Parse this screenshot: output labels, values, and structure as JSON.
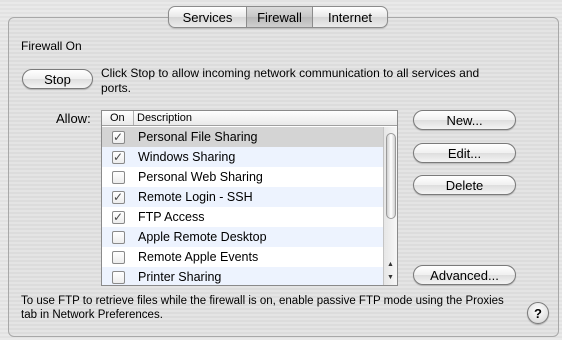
{
  "tabs": [
    {
      "label": "Services",
      "active": false
    },
    {
      "label": "Firewall",
      "active": true
    },
    {
      "label": "Internet",
      "active": false
    }
  ],
  "status_title": "Firewall On",
  "stop_button": "Stop",
  "stop_description": "Click Stop to allow incoming network communication to all services and ports.",
  "allow_label": "Allow:",
  "table": {
    "headers": {
      "on": "On",
      "description": "Description"
    },
    "rows": [
      {
        "checked": true,
        "label": "Personal File Sharing",
        "selected": true
      },
      {
        "checked": true,
        "label": "Windows Sharing",
        "selected": false
      },
      {
        "checked": false,
        "label": "Personal Web Sharing",
        "selected": false
      },
      {
        "checked": true,
        "label": "Remote Login - SSH",
        "selected": false
      },
      {
        "checked": true,
        "label": "FTP Access",
        "selected": false
      },
      {
        "checked": false,
        "label": "Apple Remote Desktop",
        "selected": false
      },
      {
        "checked": false,
        "label": "Remote Apple Events",
        "selected": false
      },
      {
        "checked": false,
        "label": "Printer Sharing",
        "selected": false
      }
    ]
  },
  "buttons": {
    "new": "New...",
    "edit": "Edit...",
    "delete": "Delete",
    "advanced": "Advanced..."
  },
  "footnote": "To use FTP to retrieve files while the firewall is on, enable passive FTP mode using the Proxies tab in Network Preferences.",
  "help_label": "?",
  "check_glyph": "✓",
  "scroll_up_glyph": "▲",
  "scroll_down_glyph": "▼"
}
